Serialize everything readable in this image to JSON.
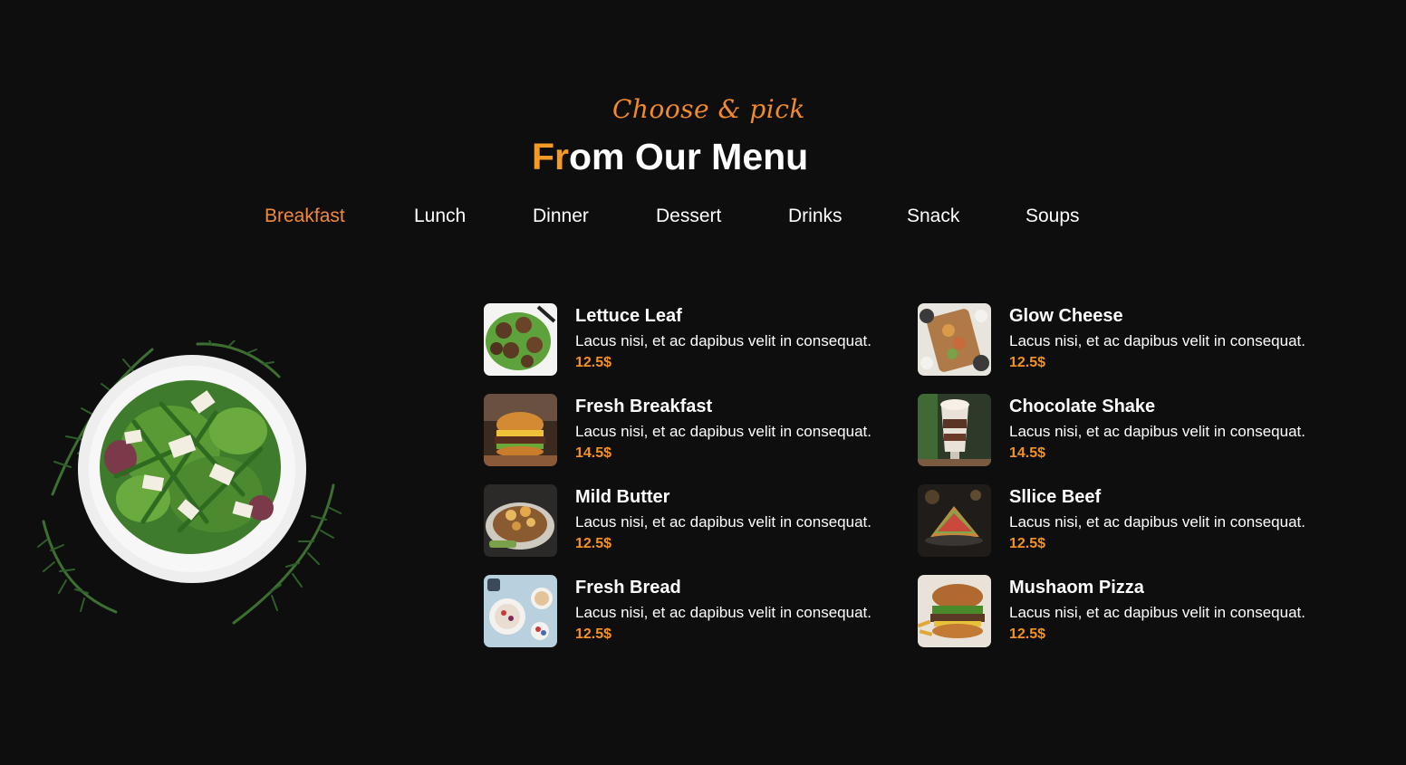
{
  "header": {
    "kicker": "Choose & pick",
    "title_accent": "Fr",
    "title_rest": "om Our Menu"
  },
  "tabs": [
    {
      "label": "Breakfast",
      "active": true
    },
    {
      "label": "Lunch",
      "active": false
    },
    {
      "label": "Dinner",
      "active": false
    },
    {
      "label": "Dessert",
      "active": false
    },
    {
      "label": "Drinks",
      "active": false
    },
    {
      "label": "Snack",
      "active": false
    },
    {
      "label": "Soups",
      "active": false
    }
  ],
  "hero": {
    "image": "salad-plate-image"
  },
  "menu": {
    "left": [
      {
        "name": "Lettuce Leaf",
        "desc": "Lacus nisi, et ac dapibus velit in consequat.",
        "price": "12.5$",
        "image": "meatball-salad-thumb"
      },
      {
        "name": "Fresh Breakfast",
        "desc": "Lacus nisi, et ac dapibus velit in consequat.",
        "price": "14.5$",
        "image": "burger-thumb"
      },
      {
        "name": "Mild Butter",
        "desc": "Lacus nisi, et ac dapibus velit in consequat.",
        "price": "12.5$",
        "image": "pork-chop-thumb"
      },
      {
        "name": "Fresh Bread",
        "desc": "Lacus nisi, et ac dapibus velit in consequat.",
        "price": "12.5$",
        "image": "breakfast-bowls-thumb"
      }
    ],
    "right": [
      {
        "name": "Glow Cheese",
        "desc": "Lacus nisi, et ac dapibus velit in consequat.",
        "price": "12.5$",
        "image": "platter-thumb"
      },
      {
        "name": "Chocolate Shake",
        "desc": "Lacus nisi, et ac dapibus velit in consequat.",
        "price": "14.5$",
        "image": "shake-thumb"
      },
      {
        "name": "Sllice Beef",
        "desc": "Lacus nisi, et ac dapibus velit in consequat.",
        "price": "12.5$",
        "image": "sandwich-thumb"
      },
      {
        "name": "Mushaom Pizza",
        "desc": "Lacus nisi, et ac dapibus velit in consequat.",
        "price": "12.5$",
        "image": "veggie-burger-thumb"
      }
    ]
  },
  "colors": {
    "background": "#0e0e0e",
    "accent": "#f59a24",
    "price": "#f5921f",
    "tab_active": "#f2883a",
    "text": "#ffffff"
  }
}
